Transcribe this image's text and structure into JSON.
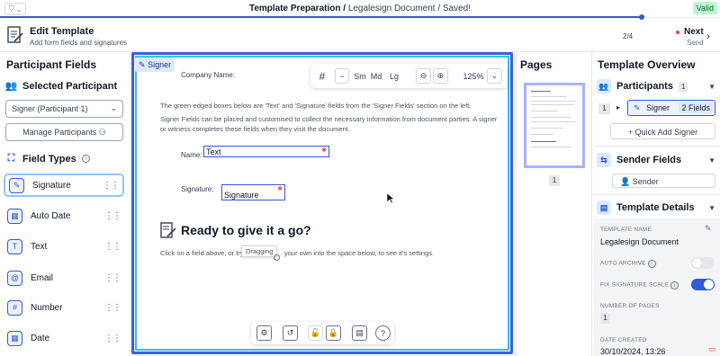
{
  "topbar": {
    "title_main": "Template Preparation /",
    "title_doc": "Legalesign Document",
    "title_saved": "/ Saved!",
    "status": "Valid"
  },
  "header": {
    "title": "Edit Template",
    "subtitle": "Add form fields and signatures",
    "step": "2/4",
    "next_label": "Next",
    "next_sub": "Send"
  },
  "left": {
    "title": "Participant Fields",
    "selected_participant": "Selected Participant",
    "participant_select": "Signer (Participant 1)",
    "manage_btn": "Manage Participants",
    "field_types": "Field Types",
    "fields": [
      {
        "label": "Signature",
        "icon": "signature-icon"
      },
      {
        "label": "Auto Date",
        "icon": "calendar-icon"
      },
      {
        "label": "Text",
        "icon": "text-icon"
      },
      {
        "label": "Email",
        "icon": "at-icon"
      },
      {
        "label": "Number",
        "icon": "hash-icon"
      },
      {
        "label": "Date",
        "icon": "calendar-icon"
      }
    ]
  },
  "document": {
    "signer_tag": "Signer",
    "company_label": "Company Name:",
    "para1": "The green-edged boxes below are 'Text' and 'Signature' fields from the 'Signer Fields' section on the left.",
    "para2": "Signer Fields can be placed and customised to collect the necessary information from document parties. A signer or witness completes these fields when they visit the document.",
    "name_label": "Name:",
    "name_field": "Text",
    "sig_label": "Signature:",
    "sig_field": "Signature",
    "ready_title": "Ready to give it a go?",
    "click_text_a": "Click on a field above, or try",
    "dragging": "Dragging",
    "click_text_b": "your own into the space below, to see it's settings."
  },
  "toolbar": {
    "hash": "#",
    "minus": "−",
    "sm": "Sm",
    "md": "Md",
    "lg": "Lg",
    "zoom": "125%"
  },
  "pages": {
    "title": "Pages",
    "page_num": "1"
  },
  "right": {
    "title": "Template Overview",
    "participants": "Participants",
    "participants_count": "1",
    "row_num": "1",
    "signer": "Signer",
    "signer_fields": "2 Fields",
    "quick_add": "Quick Add Signer",
    "sender_fields": "Sender Fields",
    "sender": "Sender",
    "template_details": "Template Details",
    "name_label": "TEMPLATE NAME",
    "name_value": "Legalesign Document",
    "auto_archive": "AUTO ARCHIVE",
    "fix_sig": "FIX SIGNATURE SCALE",
    "num_pages_label": "NUMBER OF PAGES",
    "num_pages": "1",
    "date_created_label": "DATE CREATED",
    "date_created": "30/10/2024, 13:26"
  },
  "colors": {
    "accent": "#2f5bd6",
    "valid_bg": "#bbf7d0"
  }
}
